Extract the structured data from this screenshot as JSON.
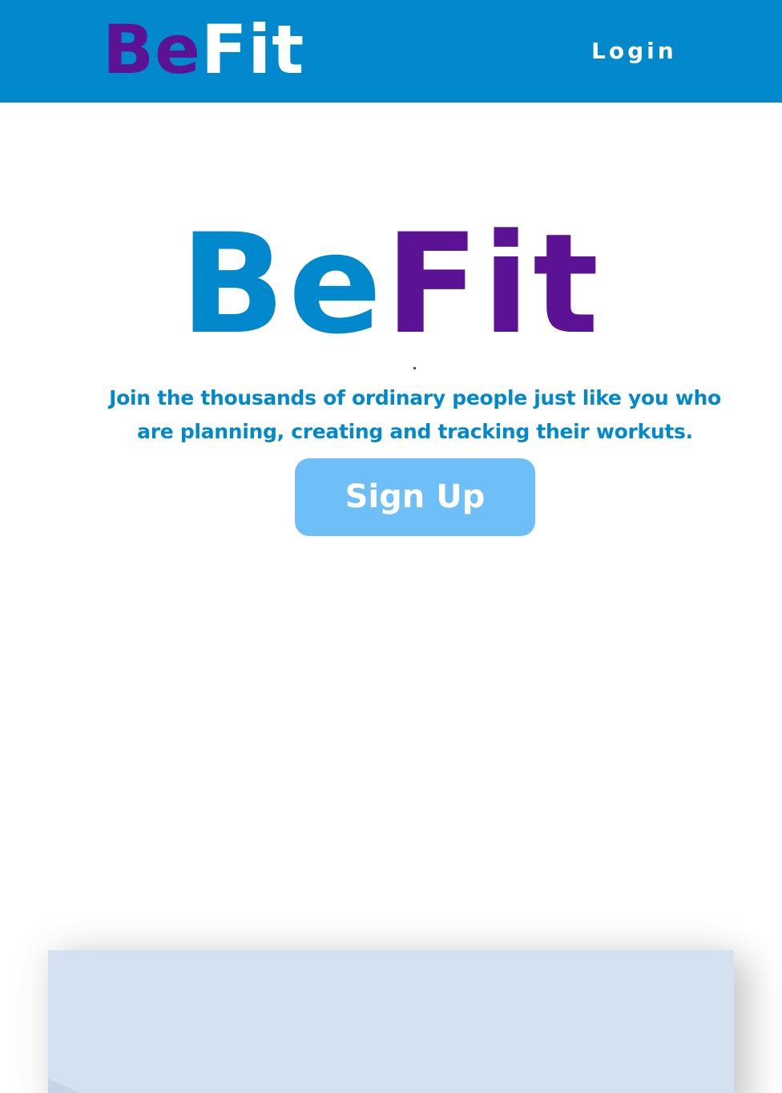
{
  "header": {
    "logo": {
      "be": "Be",
      "fit": "Fit"
    },
    "login_label": "Login"
  },
  "hero": {
    "logo": {
      "be": "Be",
      "fit": "Fit"
    },
    "tagline": "Join the thousands of ordinary people just like you who are planning, creating and tracking their workuts.",
    "signup_label": "Sign Up"
  },
  "colors": {
    "header_background": "#0288cc",
    "brand_blue": "#0288cc",
    "brand_purple": "#5b1294",
    "signup_button": "#6ebef7",
    "panel_background": "#d4e1f1"
  }
}
